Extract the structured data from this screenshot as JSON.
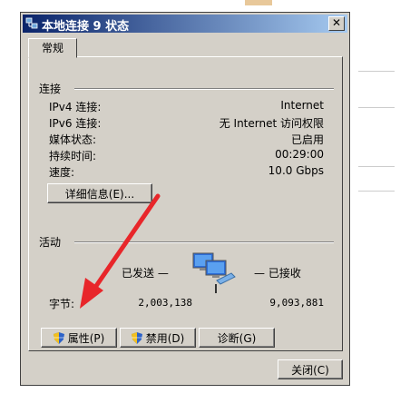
{
  "window": {
    "title": "本地连接 9 状态",
    "close_glyph": "✕"
  },
  "tabs": [
    {
      "label": "常规"
    }
  ],
  "connection": {
    "header": "连接",
    "rows": [
      {
        "label": "IPv4 连接:",
        "value": "Internet"
      },
      {
        "label": "IPv6 连接:",
        "value": "无 Internet 访问权限"
      },
      {
        "label": "媒体状态:",
        "value": "已启用"
      },
      {
        "label": "持续时间:",
        "value": "00:29:00"
      },
      {
        "label": "速度:",
        "value": "10.0 Gbps"
      }
    ],
    "details_button": "详细信息(E)..."
  },
  "activity": {
    "header": "活动",
    "sent_label": "已发送 —",
    "received_label": "— 已接收",
    "bytes_label": "字节:",
    "bytes_sent": "2,003,138",
    "bytes_received": "9,093,881"
  },
  "buttons": {
    "properties": "属性(P)",
    "disable": "禁用(D)",
    "diagnose": "诊断(G)",
    "close": "关闭(C)"
  },
  "colors": {
    "arrow": "#e8262a",
    "titlebar_start": "#0a246a",
    "titlebar_end": "#a6caf0"
  }
}
